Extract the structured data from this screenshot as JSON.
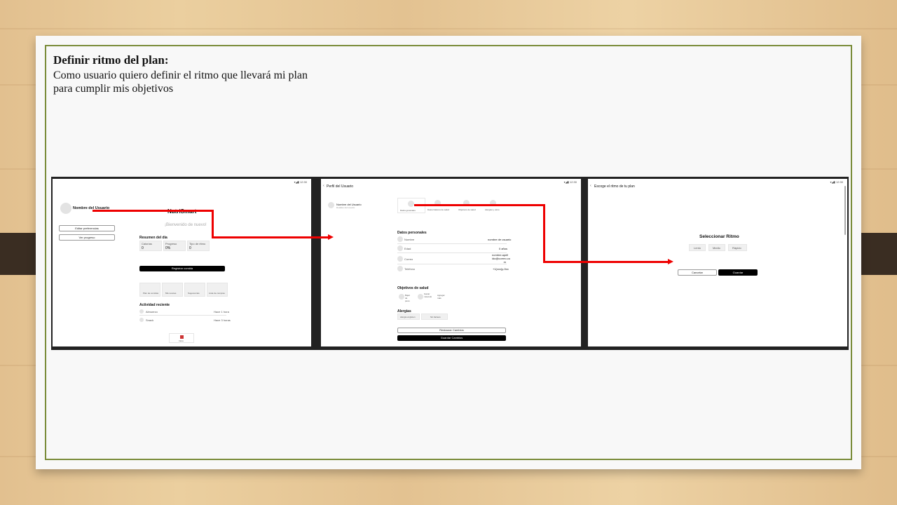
{
  "slide": {
    "title": "Definir ritmo del plan:",
    "description": "Como usuario quiero definir el ritmo que llevará mi plan para cumplir mis objetivos"
  },
  "screen1": {
    "status": "▾◢▮ 12:30",
    "user_name": "Nombre del Usuario",
    "app_title": "NutriSmart",
    "welcome": "¡Bienvenido de nuevo!",
    "edit_prefs": "Editar preferencias",
    "view_progress": "Ver progreso",
    "summary_title": "Resumen del día",
    "stats": [
      {
        "label": "Calorías",
        "value": "0"
      },
      {
        "label": "Progreso",
        "value": "0%"
      },
      {
        "label": "Tipo de ritmo",
        "value": "0"
      }
    ],
    "register_meal": "Registrar comida",
    "quick_cards": [
      "Plan de comidas",
      "Mis recetas",
      "Sugerencias",
      "Lista de compras"
    ],
    "activity_title": "Actividad reciente",
    "activities": [
      {
        "name": "Almuerzo",
        "time": "Hace 1 hora"
      },
      {
        "name": "Snack",
        "time": "Hace 3 horas"
      }
    ],
    "nav_home": "Inicio"
  },
  "screen2": {
    "status": "▾◢▮ 12:30",
    "header": "Perfil del Usuario",
    "user_name": "Nombre del Usuario",
    "user_sub": "Detalles del usuario",
    "tabs": [
      "Datos generales",
      "Datos básicos de salud",
      "Objetivos de salud",
      "Alergias y otros"
    ],
    "personal_title": "Datos personales",
    "fields": [
      {
        "label": "Nombre",
        "value": "nombre de usuario"
      },
      {
        "label": "Edad",
        "value": "0 años"
      },
      {
        "label": "Correo",
        "value": "nombre.apell ido@correo.co m"
      },
      {
        "label": "Teléfono",
        "value": "+1(xxx)y-9xx"
      }
    ],
    "goals_title": "Objetivos de salud",
    "goals": [
      "Bajar de peso",
      "Ganar músculo",
      "Agregar más"
    ],
    "allergy_title": "Alergias",
    "allergies": [
      "Alergia al gluten",
      "Sin lácteos"
    ],
    "restore": "Restaurar Cambios",
    "save": "Guardar Cambios"
  },
  "screen3": {
    "status": "▾◢▮ 12:30",
    "header": "Escoge el ritmo de tu plan",
    "select_title": "Seleccionar Ritmo",
    "options": [
      "Lento",
      "Medio",
      "Rápido"
    ],
    "cancel": "Cancelar",
    "save": "Guardar"
  },
  "colors": {
    "arrow": "#e00000",
    "slide_border": "#7a8c3a"
  },
  "icons": [
    "back-arrow-icon",
    "home-icon",
    "avatar-icon"
  ]
}
